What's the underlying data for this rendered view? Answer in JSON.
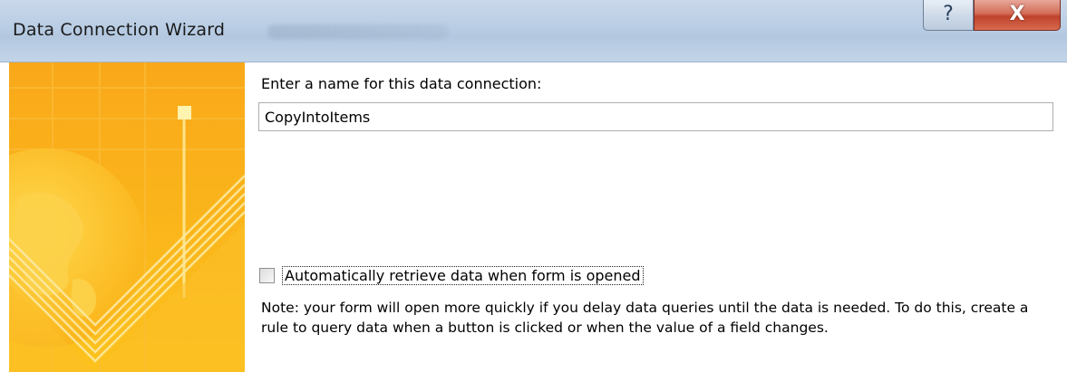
{
  "window": {
    "title": "Data Connection Wizard",
    "help_label": "?",
    "close_label": "X"
  },
  "form": {
    "name_label": "Enter a name for this data connection:",
    "name_value": "CopyIntoItems",
    "auto_retrieve_label": "Automatically retrieve data when form is opened",
    "auto_retrieve_checked": false,
    "note": "Note: your form will open more quickly if you delay data queries until the data is needed. To do this, create a rule to query data when a button is clicked or when the value of a field changes."
  },
  "colors": {
    "panel_accent": "#fdb813",
    "title_bar": "#b9cde4",
    "close_button": "#c0422b"
  }
}
